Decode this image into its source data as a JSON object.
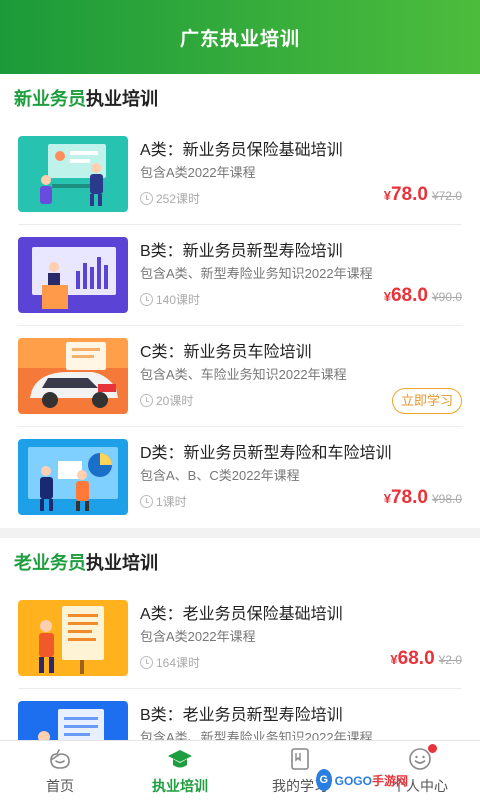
{
  "header": {
    "title": "广东执业培训"
  },
  "sections": [
    {
      "title_hl": "新业务员",
      "title_rest": "执业培训",
      "courses": [
        {
          "title": "A类：新业务员保险基础培训",
          "desc": "包含A类2022年课程",
          "hours": "252课时",
          "currency": "¥",
          "price": "78.0",
          "old_price": "¥72.0"
        },
        {
          "title": "B类：新业务员新型寿险培训",
          "desc": "包含A类、新型寿险业务知识2022年课程",
          "hours": "140课时",
          "currency": "¥",
          "price": "68.0",
          "old_price": "¥90.0"
        },
        {
          "title": "C类：新业务员车险培训",
          "desc": "包含A类、车险业务知识2022年课程",
          "hours": "20课时",
          "action": "立即学习"
        },
        {
          "title": "D类：新业务员新型寿险和车险培训",
          "desc": "包含A、B、C类2022年课程",
          "hours": "1课时",
          "currency": "¥",
          "price": "78.0",
          "old_price": "¥98.0"
        }
      ]
    },
    {
      "title_hl": "老业务员",
      "title_rest": "执业培训",
      "courses": [
        {
          "title": "A类：老业务员保险基础培训",
          "desc": "包含A类2022年课程",
          "hours": "164课时",
          "currency": "¥",
          "price": "68.0",
          "old_price": "¥2.0"
        },
        {
          "title": "B类：老业务员新型寿险培训",
          "desc": "包含A类、新型寿险业务知识2022年课程",
          "hours": "",
          "price": "",
          "old_price": ""
        }
      ]
    }
  ],
  "tabbar": {
    "items": [
      {
        "label": "首页",
        "icon": "home-icon"
      },
      {
        "label": "执业培训",
        "icon": "graduation-cap-icon",
        "active": true
      },
      {
        "label": "我的学习",
        "icon": "bookmark-icon"
      },
      {
        "label": "个人中心",
        "icon": "smiley-face-icon",
        "badge": true
      }
    ]
  },
  "watermark": {
    "logo": "G",
    "text_a": "GOGO",
    "text_b": "手游网"
  },
  "colors": {
    "brand_green": "#1e9e3e",
    "price_red": "#e8333a",
    "action_orange": "#f0a52a"
  }
}
